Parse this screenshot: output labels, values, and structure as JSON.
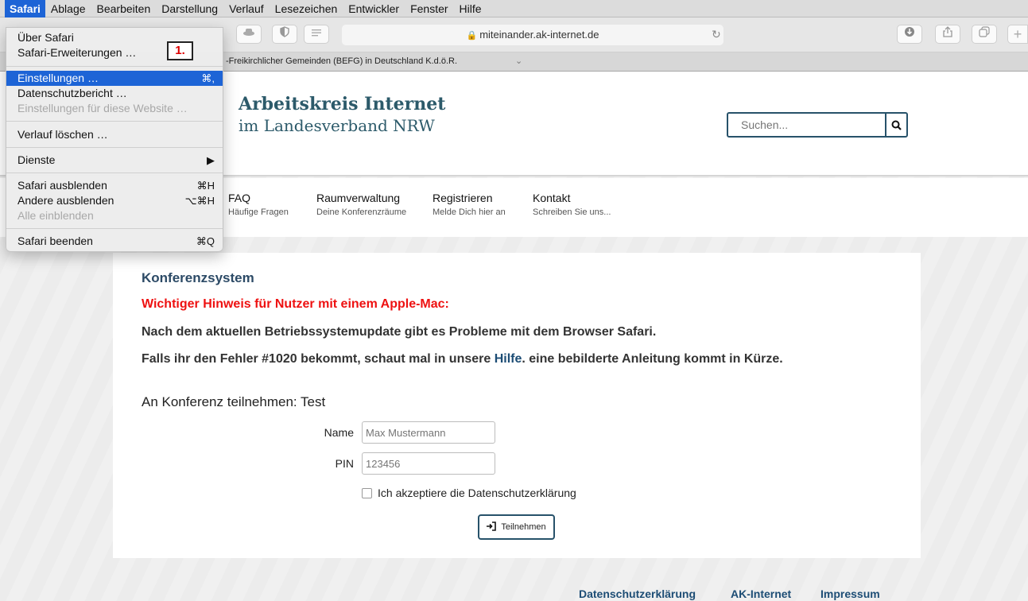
{
  "menubar": {
    "items": [
      "Safari",
      "Ablage",
      "Bearbeiten",
      "Darstellung",
      "Verlauf",
      "Lesezeichen",
      "Entwickler",
      "Fenster",
      "Hilfe"
    ]
  },
  "dropdown": {
    "about": "Über Safari",
    "extensions": "Safari-Erweiterungen …",
    "settings": {
      "label": "Einstellungen …",
      "shortcut": "⌘,"
    },
    "privacy": "Datenschutzbericht …",
    "site_settings": "Einstellungen für diese Website …",
    "clear_history": "Verlauf löschen …",
    "services": {
      "label": "Dienste",
      "arrow": "▶"
    },
    "hide_safari": {
      "label": "Safari ausblenden",
      "shortcut": "⌘H"
    },
    "hide_others": {
      "label": "Andere ausblenden",
      "shortcut": "⌥⌘H"
    },
    "show_all": "Alle einblenden",
    "quit": {
      "label": "Safari beenden",
      "shortcut": "⌘Q"
    }
  },
  "step_marker": "1.",
  "browser": {
    "url": "miteinander.ak-internet.de",
    "tab_title": "-Freikirchlicher Gemeinden (BEFG) in Deutschland K.d.ö.R."
  },
  "header": {
    "brand_line1": "Arbeitskreis Internet",
    "brand_line2": "im Landesverband NRW",
    "search_placeholder": "Suchen..."
  },
  "nav": [
    {
      "title": "FAQ",
      "sub": "Häufige Fragen"
    },
    {
      "title": "Raumverwaltung",
      "sub": "Deine Konferenzräume"
    },
    {
      "title": "Registrieren",
      "sub": "Melde Dich hier an"
    },
    {
      "title": "Kontakt",
      "sub": "Schreiben Sie uns..."
    }
  ],
  "content": {
    "heading": "Konferenzsystem",
    "warning": "Wichtiger Hinweis für Nutzer mit einem Apple-Mac:",
    "para1": "Nach dem aktuellen Betriebssystemupdate gibt es Probleme mit dem Browser Safari.",
    "para2_prefix": "Falls ihr den Fehler #1020 bekommt, schaut mal in unsere ",
    "para2_link": "Hilfe",
    "para2_suffix": ". eine bebilderte Anleitung kommt in Kürze.",
    "join_heading": "An Konferenz teilnehmen: Test",
    "name_label": "Name",
    "name_placeholder": "Max Mustermann",
    "pin_label": "PIN",
    "pin_placeholder": "123456",
    "privacy_checkbox": "Ich akzeptiere die Datenschutzerklärung",
    "join_button": "Teilnehmen"
  },
  "footer": {
    "privacy": "Datenschutzerklärung",
    "ak_internet": "AK-Internet",
    "imprint": "Impressum"
  }
}
